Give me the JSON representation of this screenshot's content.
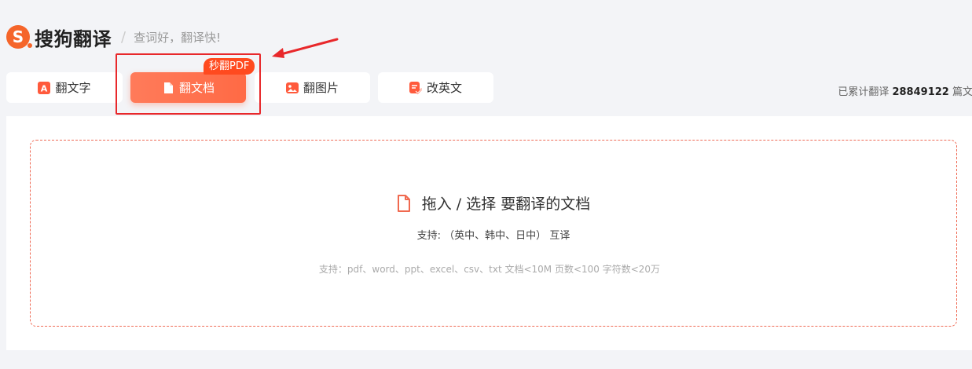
{
  "header": {
    "logo_letter": "S",
    "brand": "搜狗翻译",
    "separator": "/",
    "slogan": "查词好，翻译快!"
  },
  "tabs": [
    {
      "label": "翻文字",
      "icon": "text-translate-icon",
      "active": false
    },
    {
      "label": "翻文档",
      "icon": "document-icon",
      "active": true
    },
    {
      "label": "翻图片",
      "icon": "image-icon",
      "active": false
    },
    {
      "label": "改英文",
      "icon": "edit-check-icon",
      "active": false
    }
  ],
  "badge": "秒翻PDF",
  "counter": {
    "prefix": "已累计翻译",
    "count": "28849122",
    "suffix": "篇文档"
  },
  "dropzone": {
    "title": "拖入 / 选择 要翻译的文档",
    "support_langs": "支持: （英中、韩中、日中） 互译",
    "formats": "支持：pdf、word、ppt、excel、csv、txt    文档<10M 页数<100 字符数<20万"
  },
  "colors": {
    "accent": "#ff6a45",
    "annotation_red": "#e8282b",
    "dash_border": "#ef6a55"
  }
}
